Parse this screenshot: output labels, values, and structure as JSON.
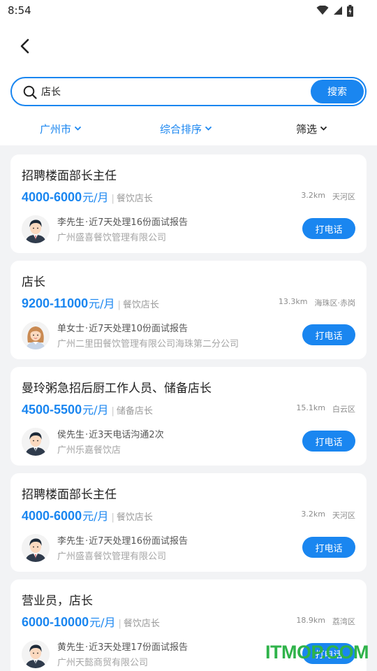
{
  "status_bar": {
    "time": "8:54",
    "icons": [
      "wifi-icon",
      "signal-icon",
      "battery-icon"
    ]
  },
  "search": {
    "value": "店长",
    "button_label": "搜索"
  },
  "filters": [
    {
      "label": "广州市",
      "active": true
    },
    {
      "label": "综合排序",
      "active": true
    },
    {
      "label": "筛选",
      "active": false
    }
  ],
  "jobs": [
    {
      "title": "招聘楼面部长主任",
      "salary": "4000-6000",
      "salary_unit": "元/月",
      "separator": "|",
      "category": "餐饮店长",
      "distance": "3.2km",
      "district": "天河区",
      "recruiter": "李先生",
      "dot": "·",
      "activity": "近7天处理16份面试报告",
      "company": "广州盛喜餐饮管理有限公司",
      "call_label": "打电话",
      "avatar": "male"
    },
    {
      "title": "店长",
      "salary": "9200-11000",
      "salary_unit": "元/月",
      "separator": "|",
      "category": "餐饮店长",
      "distance": "13.3km",
      "district": "海珠区·赤岗",
      "recruiter": "单女士",
      "dot": "·",
      "activity": "近7天处理10份面试报告",
      "company": "广州二里田餐饮管理有限公司海珠第二分公司",
      "call_label": "打电话",
      "avatar": "female"
    },
    {
      "title": "曼玲粥急招后厨工作人员、储备店长",
      "salary": "4500-5500",
      "salary_unit": "元/月",
      "separator": "|",
      "category": "储备店长",
      "distance": "15.1km",
      "district": "白云区",
      "recruiter": "侯先生",
      "dot": "·",
      "activity": "近3天电话沟通2次",
      "company": "广州乐嘉餐饮店",
      "call_label": "打电话",
      "avatar": "male"
    },
    {
      "title": "招聘楼面部长主任",
      "salary": "4000-6000",
      "salary_unit": "元/月",
      "separator": "|",
      "category": "餐饮店长",
      "distance": "3.2km",
      "district": "天河区",
      "recruiter": "李先生",
      "dot": "·",
      "activity": "近7天处理16份面试报告",
      "company": "广州盛喜餐饮管理有限公司",
      "call_label": "打电话",
      "avatar": "male"
    },
    {
      "title": "营业员，店长",
      "salary": "6000-10000",
      "salary_unit": "元/月",
      "separator": "|",
      "category": "餐饮店长",
      "distance": "18.9km",
      "district": "荔湾区",
      "recruiter": "黄先生",
      "dot": "·",
      "activity": "近3天处理17份面试报告",
      "company": "广州天懿商贸有限公司",
      "call_label": "打电话",
      "avatar": "male"
    }
  ],
  "watermark": "ITMOP.COM",
  "colors": {
    "accent": "#1a86f0",
    "watermark": "#2fb34a"
  }
}
